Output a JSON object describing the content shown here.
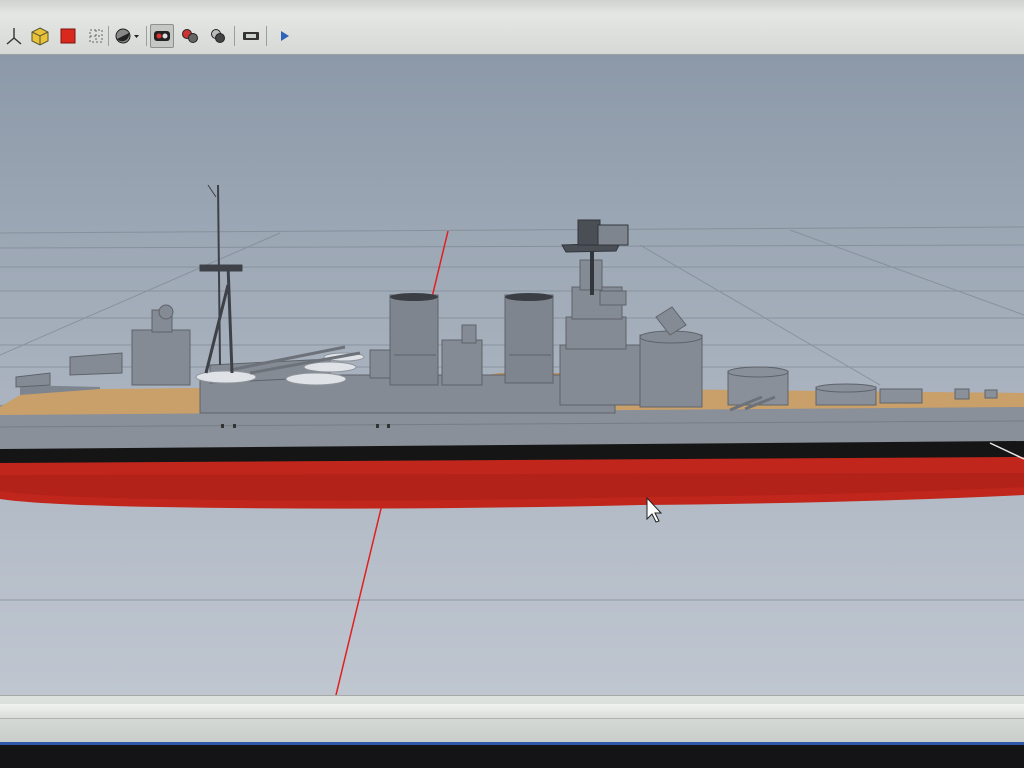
{
  "toolbar": {
    "buttons": [
      {
        "name": "axes-icon",
        "pressed": false
      },
      {
        "name": "iso-view-icon",
        "pressed": false
      },
      {
        "name": "face-style-icon",
        "pressed": false
      },
      {
        "name": "grid-icon",
        "pressed": false
      },
      {
        "name": "shading-dropdown-icon",
        "pressed": false
      },
      {
        "name": "x-ray-view-icon",
        "pressed": true
      },
      {
        "name": "hidden-geometry-icon",
        "pressed": false
      },
      {
        "name": "shadows-icon",
        "pressed": false
      },
      {
        "name": "camera-icon",
        "pressed": false
      },
      {
        "name": "play-icon",
        "pressed": false
      }
    ]
  },
  "viewport": {
    "axis_colors": {
      "red": "#e02020"
    },
    "model_colors": {
      "hull_grey": "#8a9099",
      "superstructure_grey": "#7d838c",
      "deck_wood": "#c9a06a",
      "boot_topping": "#151515",
      "waterline_red": "#c0261c"
    }
  }
}
